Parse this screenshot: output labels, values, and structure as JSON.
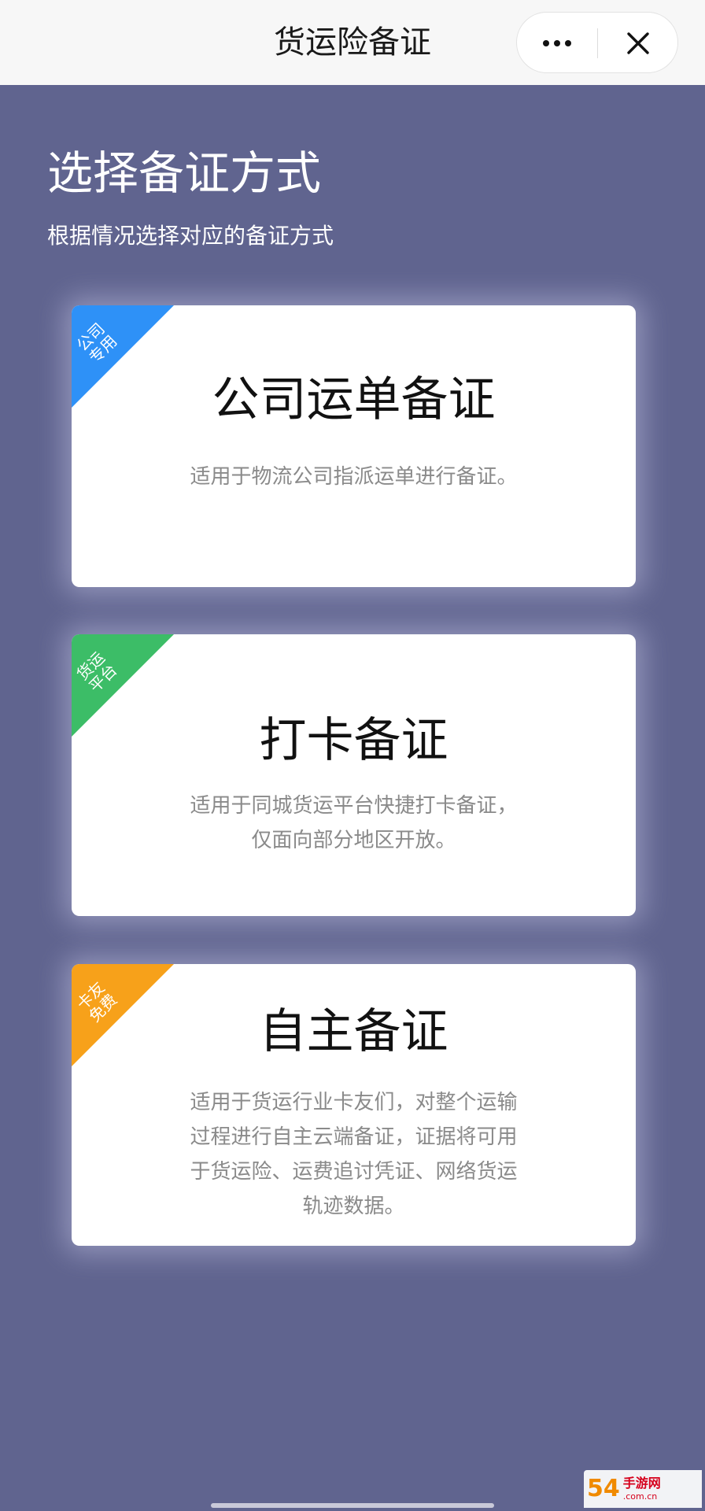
{
  "navbar": {
    "title": "货运险备证",
    "more_icon": "more-dots-icon",
    "close_icon": "close-icon"
  },
  "header": {
    "title": "选择备证方式",
    "subtitle": "根据情况选择对应的备证方式"
  },
  "cards": [
    {
      "tag_line1": "公司",
      "tag_line2": "专用",
      "tag_color": "#2e91f7",
      "title": "公司运单备证",
      "description": "适用于物流公司指派运单进行备证。"
    },
    {
      "tag_line1": "货运",
      "tag_line2": "平台",
      "tag_color": "#3cbd67",
      "title": "打卡备证",
      "description": "适用于同城货运平台快捷打卡备证，仅面向部分地区开放。"
    },
    {
      "tag_line1": "卡友",
      "tag_line2": "免费",
      "tag_color": "#f7a11a",
      "title": "自主备证",
      "description": "适用于货运行业卡友们，对整个运输过程进行自主云端备证，证据将可用于货运险、运费追讨凭证、网络货运轨迹数据。"
    }
  ],
  "watermark": {
    "number": "54",
    "name": "手游网",
    "domain": ".com.cn"
  },
  "colors": {
    "background": "#60648f",
    "navbar": "#f7f7f7",
    "card": "#ffffff"
  }
}
